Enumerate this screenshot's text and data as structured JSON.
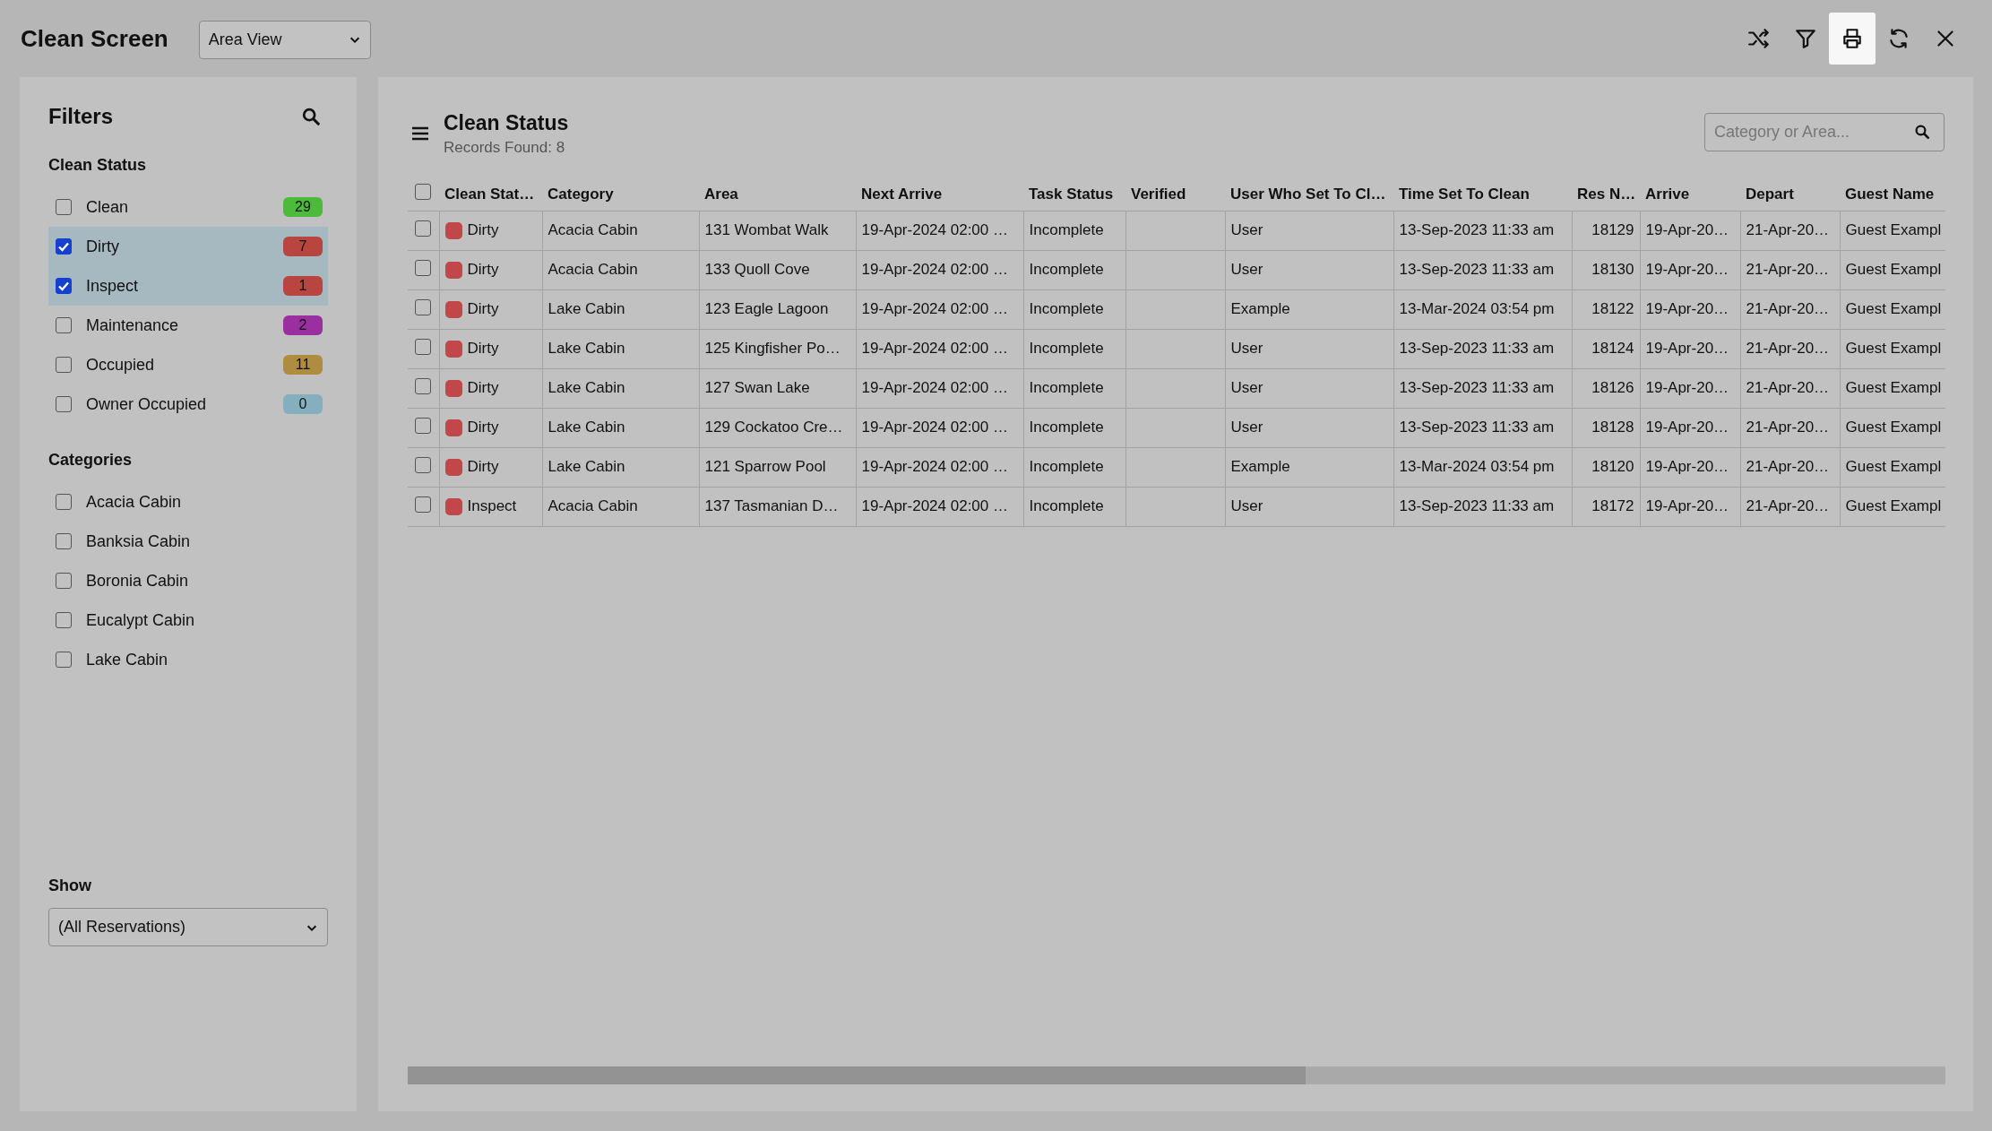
{
  "header": {
    "title": "Clean Screen",
    "view_select": {
      "value": "Area View"
    },
    "toolbar": [
      {
        "kind": "shuffle",
        "selected": false
      },
      {
        "kind": "filter",
        "selected": false
      },
      {
        "kind": "print",
        "selected": true
      },
      {
        "kind": "refresh",
        "selected": false
      },
      {
        "kind": "close",
        "selected": false
      }
    ]
  },
  "filters": {
    "title": "Filters",
    "clean_status": {
      "heading": "Clean Status",
      "items": [
        {
          "label": "Clean",
          "checked": false,
          "count": "29",
          "color": "#4cbb3c"
        },
        {
          "label": "Dirty",
          "checked": true,
          "count": "7",
          "color": "#b84540"
        },
        {
          "label": "Inspect",
          "checked": true,
          "count": "1",
          "color": "#b84540"
        },
        {
          "label": "Maintenance",
          "checked": false,
          "count": "2",
          "color": "#9a2fa0"
        },
        {
          "label": "Occupied",
          "checked": false,
          "count": "11",
          "color": "#b08c40"
        },
        {
          "label": "Owner Occupied",
          "checked": false,
          "count": "0",
          "color": "#85aebf"
        }
      ]
    },
    "categories": {
      "heading": "Categories",
      "items": [
        {
          "label": "Acacia Cabin",
          "checked": false
        },
        {
          "label": "Banksia Cabin",
          "checked": false
        },
        {
          "label": "Boronia Cabin",
          "checked": false
        },
        {
          "label": "Eucalypt Cabin",
          "checked": false
        },
        {
          "label": "Lake Cabin",
          "checked": false
        }
      ]
    },
    "show": {
      "label": "Show",
      "value": "(All Reservations)"
    }
  },
  "main": {
    "title": "Clean Status",
    "records": "Records Found: 8",
    "search": {
      "placeholder": "Category or Area..."
    },
    "table": {
      "all_checked": false,
      "columns": [
        "Clean Stat…",
        "Category",
        "Area",
        "Next Arrive",
        "Task Status",
        "Verified",
        "User Who Set To Cl…",
        "Time Set To Clean",
        "Res N…",
        "Arrive",
        "Depart",
        "Guest Name"
      ],
      "rows": [
        {
          "checked": false,
          "status": "Dirty",
          "color": "#c0484a",
          "category": "Acacia Cabin",
          "area": "131 Wombat Walk",
          "next_arrive": "19-Apr-2024 02:00 …",
          "task_status": "Incomplete",
          "user": "User",
          "time_set": "13-Sep-2023 11:33 am",
          "res_no": "18129",
          "arrive": "19-Apr-20…",
          "depart": "21-Apr-20…",
          "guest": "Guest Exampl"
        },
        {
          "checked": false,
          "status": "Dirty",
          "color": "#c0484a",
          "category": "Acacia Cabin",
          "area": "133 Quoll Cove",
          "next_arrive": "19-Apr-2024 02:00 …",
          "task_status": "Incomplete",
          "user": "User",
          "time_set": "13-Sep-2023 11:33 am",
          "res_no": "18130",
          "arrive": "19-Apr-20…",
          "depart": "21-Apr-20…",
          "guest": "Guest Exampl"
        },
        {
          "checked": false,
          "status": "Dirty",
          "color": "#c0484a",
          "category": "Lake Cabin",
          "area": "123 Eagle Lagoon",
          "next_arrive": "19-Apr-2024 02:00 …",
          "task_status": "Incomplete",
          "user": "Example",
          "time_set": "13-Mar-2024 03:54 pm",
          "res_no": "18122",
          "arrive": "19-Apr-20…",
          "depart": "21-Apr-20…",
          "guest": "Guest Exampl"
        },
        {
          "checked": false,
          "status": "Dirty",
          "color": "#c0484a",
          "category": "Lake Cabin",
          "area": "125 Kingfisher Po…",
          "next_arrive": "19-Apr-2024 02:00 …",
          "task_status": "Incomplete",
          "user": "User",
          "time_set": "13-Sep-2023 11:33 am",
          "res_no": "18124",
          "arrive": "19-Apr-20…",
          "depart": "21-Apr-20…",
          "guest": "Guest Exampl"
        },
        {
          "checked": false,
          "status": "Dirty",
          "color": "#c0484a",
          "category": "Lake Cabin",
          "area": "127 Swan Lake",
          "next_arrive": "19-Apr-2024 02:00 …",
          "task_status": "Incomplete",
          "user": "User",
          "time_set": "13-Sep-2023 11:33 am",
          "res_no": "18126",
          "arrive": "19-Apr-20…",
          "depart": "21-Apr-20…",
          "guest": "Guest Exampl"
        },
        {
          "checked": false,
          "status": "Dirty",
          "color": "#c0484a",
          "category": "Lake Cabin",
          "area": "129 Cockatoo Cre…",
          "next_arrive": "19-Apr-2024 02:00 …",
          "task_status": "Incomplete",
          "user": "User",
          "time_set": "13-Sep-2023 11:33 am",
          "res_no": "18128",
          "arrive": "19-Apr-20…",
          "depart": "21-Apr-20…",
          "guest": "Guest Exampl"
        },
        {
          "checked": false,
          "status": "Dirty",
          "color": "#c0484a",
          "category": "Lake Cabin",
          "area": "121 Sparrow Pool",
          "next_arrive": "19-Apr-2024 02:00 …",
          "task_status": "Incomplete",
          "user": "Example",
          "time_set": "13-Mar-2024 03:54 pm",
          "res_no": "18120",
          "arrive": "19-Apr-20…",
          "depart": "21-Apr-20…",
          "guest": "Guest Exampl"
        },
        {
          "checked": false,
          "status": "Inspect",
          "color": "#c0484a",
          "category": "Acacia Cabin",
          "area": "137 Tasmanian D…",
          "next_arrive": "19-Apr-2024 02:00 …",
          "task_status": "Incomplete",
          "user": "User",
          "time_set": "13-Sep-2023 11:33 am",
          "res_no": "18172",
          "arrive": "19-Apr-20…",
          "depart": "21-Apr-20…",
          "guest": "Guest Exampl"
        }
      ]
    }
  }
}
